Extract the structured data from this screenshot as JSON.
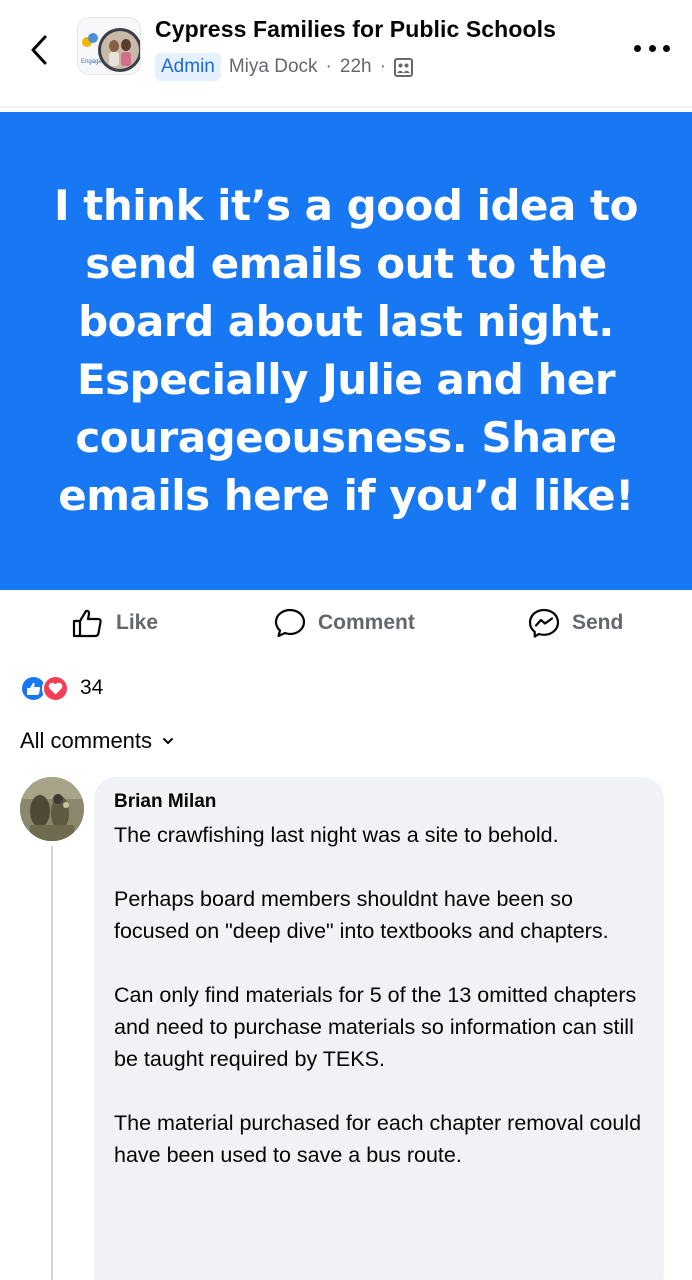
{
  "header": {
    "group_name": "Cypress Families for Public Schools",
    "role_badge": "Admin",
    "author": "Miya Dock",
    "separator": "·",
    "time": "22h",
    "avatar_caption": "Engage"
  },
  "post": {
    "text": "I think it’s a good idea to send emails out to the board about last night. Especially Julie and her courageousness. Share emails here if you’d like!",
    "background_color": "#1877f2"
  },
  "actions": {
    "like_label": "Like",
    "comment_label": "Comment",
    "send_label": "Send"
  },
  "reactions": {
    "count": "34",
    "types": [
      "like-icon",
      "love-icon"
    ]
  },
  "comments_filter": {
    "label": "All comments"
  },
  "comment": {
    "author": "Brian Milan",
    "paragraphs": [
      "The crawfishing last night was a site to behold.",
      "Perhaps board members shouldnt have been so focused on \"deep dive\" into textbooks and chapters.",
      "Can only find materials for 5 of the 13 omitted chapters and need to purchase materials so information can still be taught required by TEKS.",
      "The material purchased for each chapter removal could have been used to save a bus route."
    ]
  }
}
